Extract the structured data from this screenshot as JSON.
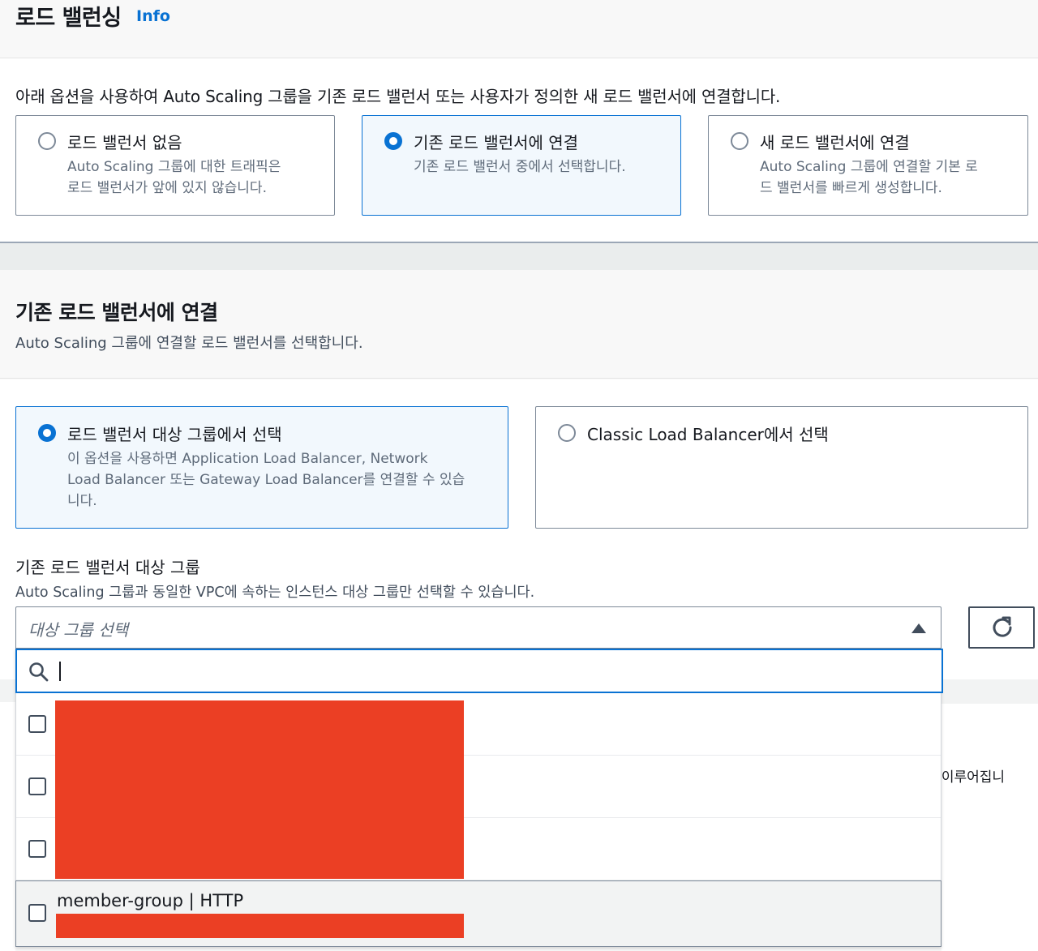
{
  "load_balancing": {
    "title": "로드 밸런싱",
    "info_link": "Info",
    "description": "아래 옵션을 사용하여 Auto Scaling 그룹을 기존 로드 밸런서 또는 사용자가 정의한 새 로드 밸런서에 연결합니다.",
    "options": [
      {
        "label": "로드 밸런서 없음",
        "desc_line1": "Auto Scaling 그룹에 대한 트래픽은",
        "desc_line2": "로드 밸런서가 앞에 있지 않습니다.",
        "selected": false
      },
      {
        "label": "기존 로드 밸런서에 연결",
        "desc_line1": "기존 로드 밸런서 중에서 선택합니다.",
        "desc_line2": "",
        "selected": true
      },
      {
        "label": "새 로드 밸런서에 연결",
        "desc_line1": "Auto Scaling 그룹에 연결할 기본 로",
        "desc_line2": "드 밸런서를 빠르게 생성합니다.",
        "selected": false
      }
    ]
  },
  "attach_existing": {
    "title": "기존 로드 밸런서에 연결",
    "description": "Auto Scaling 그룹에 연결할 로드 밸런서를 선택합니다.",
    "options": [
      {
        "label": "로드 밸런서 대상 그룹에서 선택",
        "desc_line1": "이 옵션을 사용하면 Application Load Balancer, Network",
        "desc_line2": "Load Balancer 또는 Gateway Load Balancer를 연결할 수 있습",
        "desc_line3": "니다.",
        "selected": true
      },
      {
        "label": "Classic Load Balancer에서 선택",
        "selected": false
      }
    ]
  },
  "target_group_field": {
    "label": "기존 로드 밸런서 대상 그룹",
    "description": "Auto Scaling 그룹과 동일한 VPC에 속하는 인스턴스 대상 그룹만 선택할 수 있습니다.",
    "placeholder": "대상 그룹 선택",
    "search_value": "",
    "items": [
      {
        "label": "",
        "checked": false
      },
      {
        "label": "",
        "checked": false
      },
      {
        "label": "",
        "checked": false
      },
      {
        "label": "member-group | HTTP",
        "checked": false
      }
    ]
  },
  "background_text": "이루어집니",
  "colors": {
    "accent": "#0972d3",
    "redaction": "#eb3f24",
    "selected_bg": "#f2f8fd"
  },
  "icons": [
    "search-icon",
    "refresh-icon",
    "caret-up-icon"
  ]
}
